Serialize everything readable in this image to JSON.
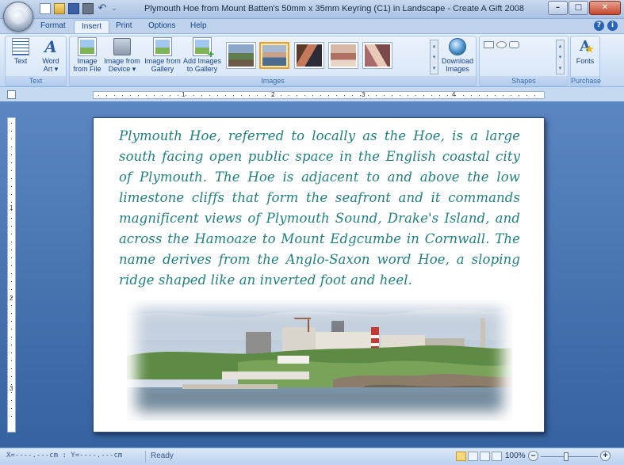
{
  "window": {
    "title": "Plymouth Hoe from Mount Batten's 50mm x 35mm Keyring (C1) in Landscape - Create A Gift 2008",
    "controls": {
      "minimize": "–",
      "maximize": "□",
      "close": "✕"
    }
  },
  "quick_access": {
    "undo": "↶",
    "more": "⌄"
  },
  "tabs": [
    "Format",
    "Insert",
    "Print",
    "Options",
    "Help"
  ],
  "active_tab": "Insert",
  "help_icons": {
    "help": "?",
    "info": "i"
  },
  "ribbon": {
    "text_group": {
      "label": "Text",
      "text_button": "Text",
      "wordart_button_1": "Word",
      "wordart_button_2": "Art ▾"
    },
    "images_group": {
      "label": "Images",
      "from_file_1": "Image",
      "from_file_2": "from File",
      "from_device_1": "Image from",
      "from_device_2": "Device ▾",
      "from_gallery_1": "Image from",
      "from_gallery_2": "Gallery",
      "add_gallery_1": "Add Images",
      "add_gallery_2": "to Gallery",
      "download_1": "Download",
      "download_2": "Images",
      "thumbnail_count": 5,
      "selected_thumbnail": 2
    },
    "shapes_group": {
      "label": "Shapes"
    },
    "purchase_group": {
      "label": "Purchase",
      "fonts_button": "Fonts"
    }
  },
  "ruler": {
    "h_labels": [
      "1",
      "2",
      "3",
      "4"
    ],
    "v_labels": [
      "1",
      "2",
      "3"
    ]
  },
  "document": {
    "paragraph": "Plymouth Hoe, referred to locally as the Hoe, is a large south facing open public space in the English coastal city of Plymouth. The Hoe is adjacent to and above the low limestone cliffs that form the seafront and it commands magnificent views of Plymouth Sound, Drake's Island, and across the Hamoaze to Mount Edgcumbe in Cornwall. The name derives from the Anglo-Saxon word Hoe, a sloping ridge shaped like an inverted foot and heel.",
    "text_color": "#1f7f80"
  },
  "status": {
    "coords": "X=----.---cm : Y=----.---cm",
    "ready": "Ready",
    "zoom": "100%",
    "zoom_minus": "–",
    "zoom_plus": "+"
  }
}
